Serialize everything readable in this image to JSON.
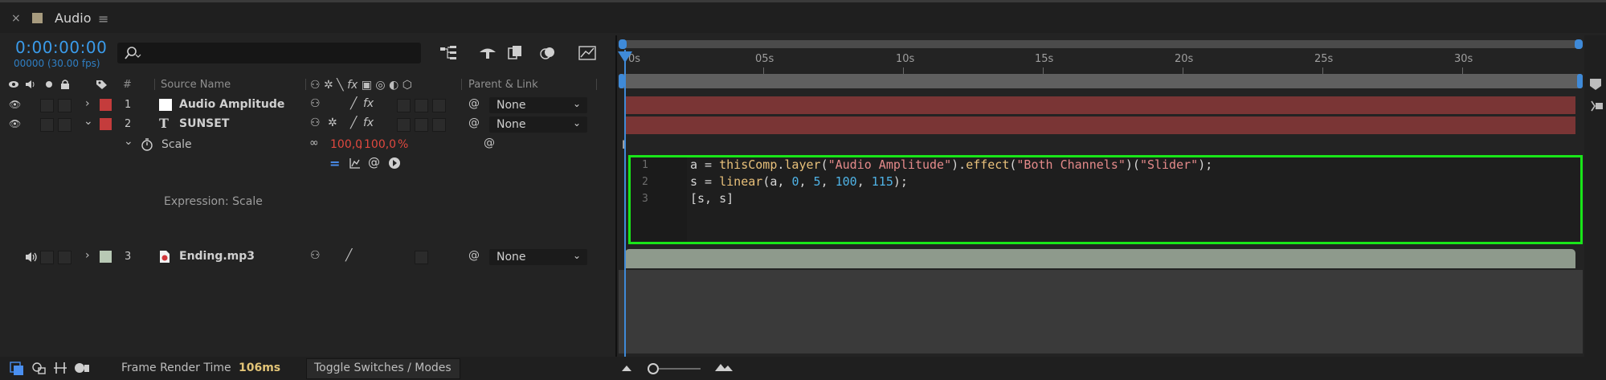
{
  "panel": {
    "close": "×",
    "title": "Audio",
    "menu": "≡",
    "swatch_color": "#a79b7e"
  },
  "header": {
    "timecode": "0:00:00:00",
    "frame_info": "00000 (30.00 fps)",
    "search_icon": "search-icon",
    "search_value": ""
  },
  "columns": {
    "num": "#",
    "source_name": "Source Name",
    "parent_link": "Parent & Link"
  },
  "layers": [
    {
      "number": "1",
      "name": "Audio Amplitude",
      "label_color": "#c43c3c",
      "type_icon": "solid-white",
      "parent": "None",
      "expanded": false
    },
    {
      "number": "2",
      "name": "SUNSET",
      "label_color": "#c43c3c",
      "type_icon": "T",
      "parent": "None",
      "expanded": true
    },
    {
      "number": "3",
      "name": "Ending.mp3",
      "label_color": "#b8c9b5",
      "type_icon": "audio-file",
      "parent": "None",
      "expanded": false
    }
  ],
  "scale_property": {
    "name": "Scale",
    "value_a": "100,0",
    "sep": ",",
    "value_b": "100,0",
    "unit": "%"
  },
  "expression_label": "Expression: Scale",
  "ruler": {
    "labels": [
      "0s",
      "05s",
      "10s",
      "15s",
      "20s",
      "25s",
      "30s"
    ]
  },
  "expression": {
    "line_numbers": [
      "1",
      "2",
      "3"
    ],
    "lines": [
      "a = thisComp.layer(\"Audio Amplitude\").effect(\"Both Channels\")(\"Slider\");",
      "s = linear(a, 0, 5, 100, 115);",
      "[s, s]"
    ],
    "highlight_color": "#19e619"
  },
  "status": {
    "frame_render_label": "Frame Render Time",
    "frame_render_value": "106ms",
    "toggle_label": "Toggle Switches / Modes"
  }
}
